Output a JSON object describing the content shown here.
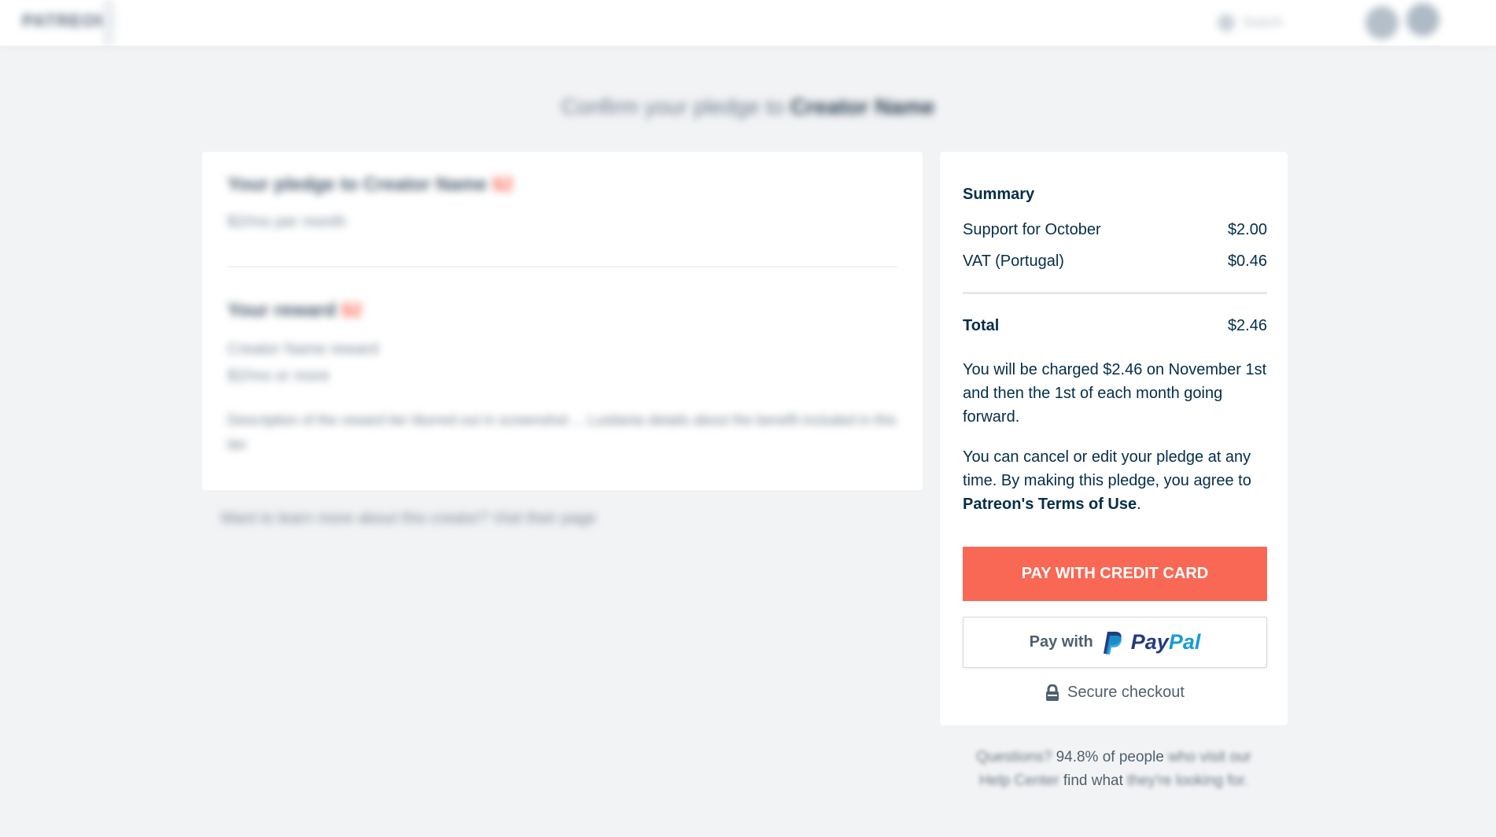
{
  "header": {
    "logo_text": "PATREON",
    "search_placeholder": "Search"
  },
  "page_title": {
    "prefix": "Confirm your pledge to",
    "creator": "Creator Name"
  },
  "left_card": {
    "pledge_heading": "Your pledge to Creator Name",
    "pledge_price": "$2",
    "pledge_sub": "$2/mo per month",
    "reward_heading": "Your reward",
    "reward_price": "$2",
    "reward_line1": "Creator Name reward",
    "reward_line2": "$2/mo or more",
    "reward_description": "Description of the reward tier blurred out in screenshot ... Lusitania details about the benefit included in this tier",
    "below_text": "Want to learn more about this creator? Visit their page"
  },
  "summary": {
    "title": "Summary",
    "rows": [
      {
        "label": "Support for October",
        "value": "$2.00"
      },
      {
        "label": "VAT (Portugal)",
        "value": "$0.46"
      }
    ],
    "total_label": "Total",
    "total_value": "$2.46",
    "charge_note": "You will be charged $2.46 on November 1st and then the 1st of each month going forward.",
    "cancel_note_prefix": "You can cancel or edit your pledge at any time. By making this pledge, you agree to",
    "terms_link": "Patreon's Terms of Use",
    "cancel_note_suffix": ".",
    "pay_credit_card_label": "PAY WITH CREDIT CARD",
    "pay_paypal_prefix": "Pay with",
    "paypal_pay": "Pay",
    "paypal_pal": "Pal",
    "secure_label": "Secure checkout",
    "accent_color": "#f96854"
  },
  "footer": {
    "q_prefix": "Questions?",
    "q_visible": "94.8% of people",
    "q_who": "who",
    "q_rest1": "visit our",
    "q_link": "Help Center",
    "q_find": "find what",
    "q_rest2": "they're looking for."
  }
}
